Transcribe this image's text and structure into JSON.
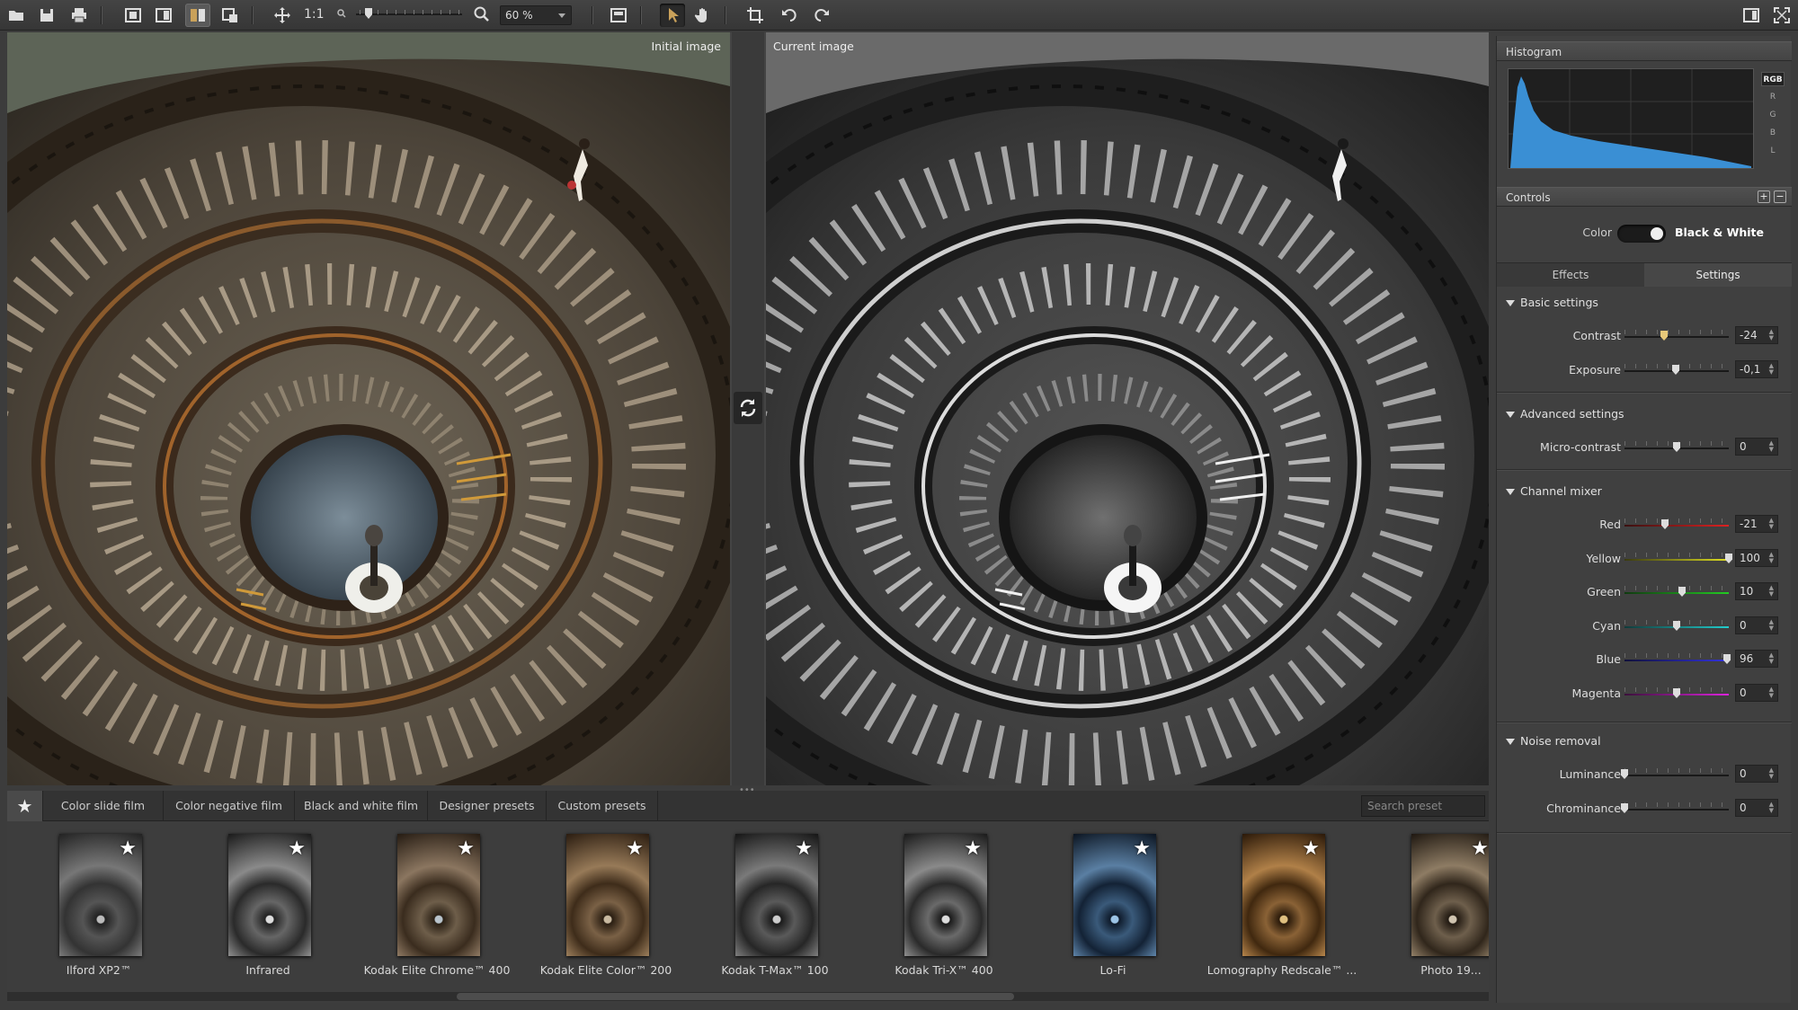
{
  "toolbar": {
    "zoom_one_to_one": "1:1",
    "zoom_value": "60 %"
  },
  "viewer": {
    "initial_label": "Initial image",
    "current_label": "Current image"
  },
  "presets": {
    "tabs": [
      "Color slide film",
      "Color negative film",
      "Black and white film",
      "Designer presets",
      "Custom presets"
    ],
    "search_placeholder": "Search preset",
    "items": [
      {
        "name": "Ilford XP2™"
      },
      {
        "name": "Infrared"
      },
      {
        "name": "Kodak Elite Chrome™ 400"
      },
      {
        "name": "Kodak Elite Color™ 200"
      },
      {
        "name": "Kodak T-Max™ 100"
      },
      {
        "name": "Kodak Tri-X™ 400"
      },
      {
        "name": "Lo-Fi"
      },
      {
        "name": "Lomography Redscale™ ..."
      },
      {
        "name": "Photo 19..."
      }
    ]
  },
  "panel": {
    "histogram_title": "Histogram",
    "histogram_channels": [
      "RGB",
      "R",
      "G",
      "B",
      "L"
    ],
    "controls_title": "Controls",
    "mode_left": "Color",
    "mode_right": "Black & White",
    "tab_effects": "Effects",
    "tab_settings": "Settings",
    "groups": {
      "basic": {
        "title": "Basic settings",
        "sliders": [
          {
            "label": "Contrast",
            "value": "-24"
          },
          {
            "label": "Exposure",
            "value": "-0,1"
          }
        ]
      },
      "advanced": {
        "title": "Advanced settings",
        "sliders": [
          {
            "label": "Micro-contrast",
            "value": "0"
          }
        ]
      },
      "mixer": {
        "title": "Channel mixer",
        "sliders": [
          {
            "label": "Red",
            "value": "-21"
          },
          {
            "label": "Yellow",
            "value": "100"
          },
          {
            "label": "Green",
            "value": "10"
          },
          {
            "label": "Cyan",
            "value": "0"
          },
          {
            "label": "Blue",
            "value": "96"
          },
          {
            "label": "Magenta",
            "value": "0"
          }
        ]
      },
      "noise": {
        "title": "Noise removal",
        "sliders": [
          {
            "label": "Luminance",
            "value": "0"
          },
          {
            "label": "Chrominance",
            "value": "0"
          }
        ]
      }
    }
  }
}
